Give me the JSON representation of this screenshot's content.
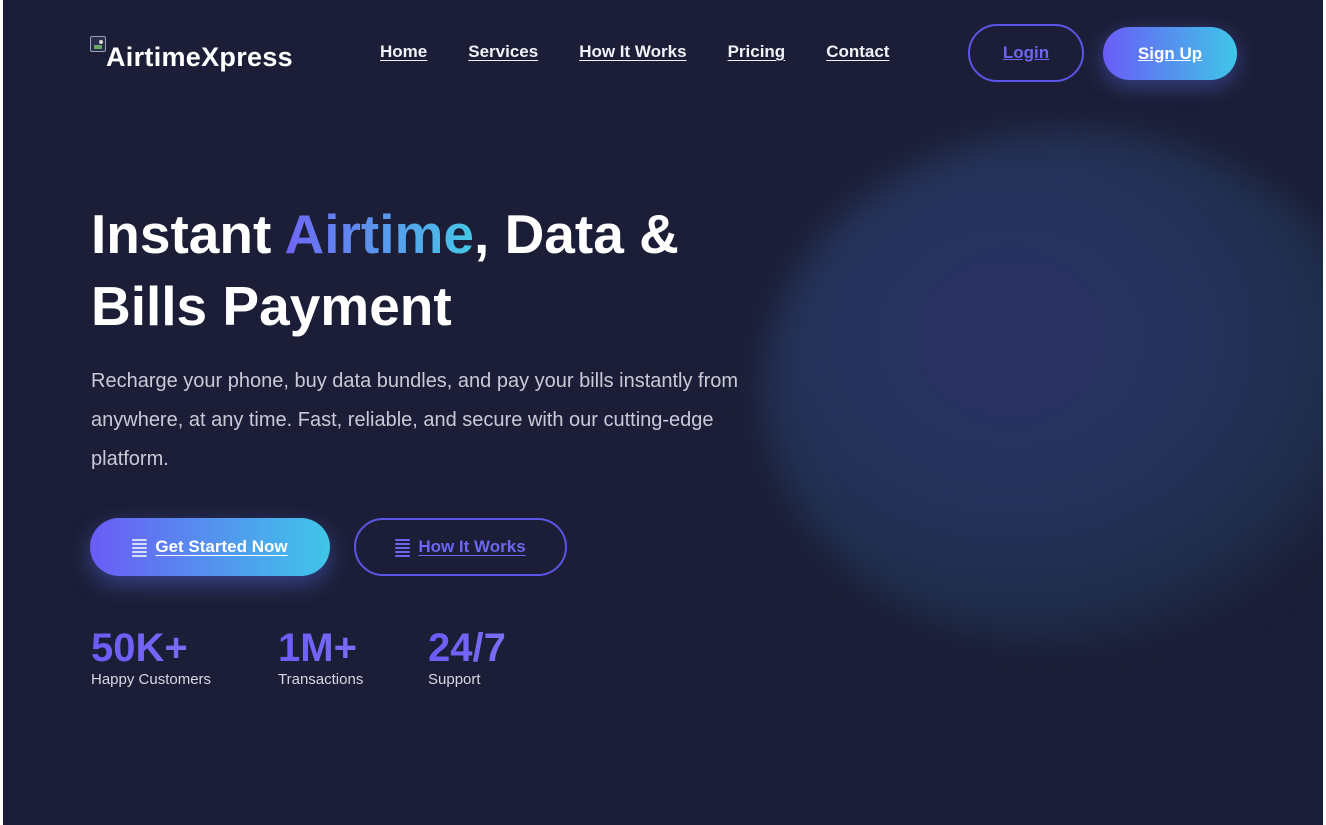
{
  "brand": {
    "name": "AirtimeXpress",
    "logo_icon": "broken-image-icon"
  },
  "nav": {
    "items": [
      {
        "label": "Home"
      },
      {
        "label": "Services"
      },
      {
        "label": "How It Works"
      },
      {
        "label": "Pricing"
      },
      {
        "label": "Contact"
      }
    ],
    "login_label": "Login",
    "signup_label": "Sign Up"
  },
  "hero": {
    "title_part1": "Instant ",
    "title_accent": "Airtime",
    "title_part2": ", Data & Bills Payment",
    "subtitle": "Recharge your phone, buy data bundles, and pay your bills instantly from anywhere, at any time. Fast, reliable, and secure with our cutting-edge platform.",
    "primary_cta": "Get Started Now",
    "secondary_cta": "How It Works",
    "cta_icon": "list-icon"
  },
  "stats": [
    {
      "value": "50K+",
      "label": "Happy Customers"
    },
    {
      "value": "1M+",
      "label": "Transactions"
    },
    {
      "value": "24/7",
      "label": "Support"
    }
  ],
  "colors": {
    "background": "#1b1e36",
    "accent_purple": "#6a5cf6",
    "accent_cyan": "#3fc6e8",
    "text_primary": "#ffffff",
    "text_muted": "#c9cad8"
  }
}
